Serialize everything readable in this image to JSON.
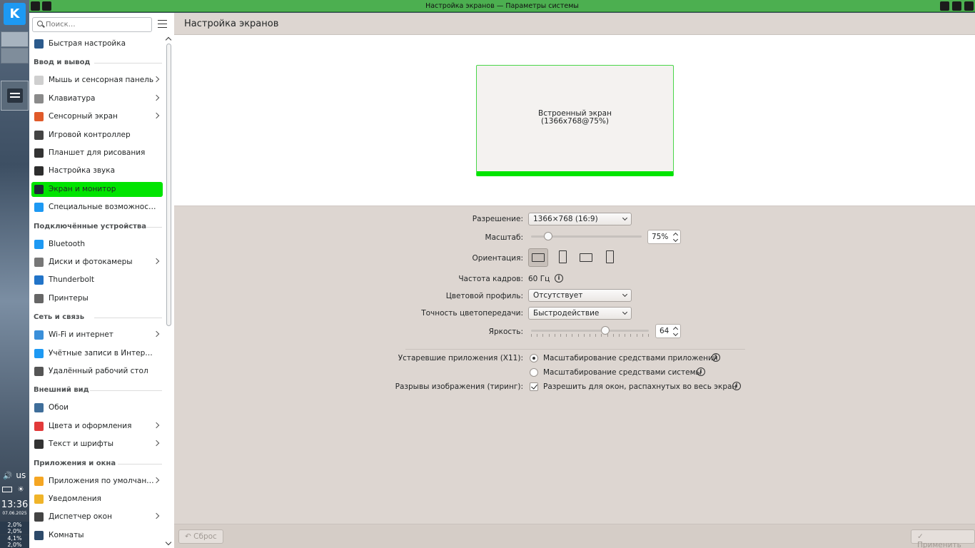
{
  "window": {
    "title": "Настройка экранов — Параметры системы"
  },
  "panel": {
    "keyboard_layout": "us",
    "clock": "13:36",
    "date": "07.06.2025",
    "cpu_row1": "2,0% 2,0%",
    "cpu_row2": "4,1% 2,0%"
  },
  "sidebar": {
    "search_placeholder": "Поиск…",
    "items": [
      {
        "label": "Быстрая настройка",
        "color": "#2b5a8c"
      },
      {
        "section": "Ввод и вывод"
      },
      {
        "label": "Мышь и сенсорная панель",
        "color": "#cfcfcf"
      },
      {
        "label": "Клавиатура",
        "color": "#8a8a8a"
      },
      {
        "label": "Сенсорный экран",
        "color": "#e05a2a"
      },
      {
        "label": "Игровой контроллер",
        "color": "#444444"
      },
      {
        "label": "Планшет для рисования",
        "color": "#333333"
      },
      {
        "label": "Настройка звука",
        "color": "#2d2d2d"
      },
      {
        "label": "Экран и монитор",
        "color": "#1f2a36"
      },
      {
        "label": "Специальные возможнос…",
        "color": "#1d99f3"
      },
      {
        "section": "Подключённые устройства"
      },
      {
        "label": "Bluetooth",
        "color": "#1d99f3"
      },
      {
        "label": "Диски и фотокамеры",
        "color": "#777777"
      },
      {
        "label": "Thunderbolt",
        "color": "#2274c8"
      },
      {
        "label": "Принтеры",
        "color": "#666666"
      },
      {
        "section": "Сеть и связь"
      },
      {
        "label": "Wi-Fi и интернет",
        "color": "#3a8fd9"
      },
      {
        "label": "Учётные записи в Интер…",
        "color": "#1d99f3"
      },
      {
        "label": "Удалённый рабочий стол",
        "color": "#555555"
      },
      {
        "section": "Внешний вид"
      },
      {
        "label": "Обои",
        "color": "#3f6e9a"
      },
      {
        "label": "Цвета и оформления",
        "color": "#e23a3a"
      },
      {
        "label": "Текст и шрифты",
        "color": "#333333"
      },
      {
        "section": "Приложения и окна"
      },
      {
        "label": "Приложения по умолчан…",
        "color": "#f5a623"
      },
      {
        "label": "Уведомления",
        "color": "#f0b429"
      },
      {
        "label": "Диспетчер окон",
        "color": "#444444"
      },
      {
        "label": "Комнаты",
        "color": "#2d4a6a"
      }
    ]
  },
  "main": {
    "title": "Настройка экранов",
    "screen_name": "Встроенный экран",
    "screen_mode": "(1366x768@75%)",
    "resolution_label": "Разрешение:",
    "resolution_value": "1366×768 (16:9)",
    "scale_label": "Масштаб:",
    "scale_value": "75%",
    "scale_fraction": 0.125,
    "orientation_label": "Ориентация:",
    "refresh_label": "Частота кадров:",
    "refresh_value": "60 Гц",
    "color_profile_label": "Цветовой профиль:",
    "color_profile_value": "Отсутствует",
    "color_accuracy_label": "Точность цветопередачи:",
    "color_accuracy_value": "Быстродействие",
    "brightness_label": "Яркость:",
    "brightness_value": "64",
    "brightness_fraction": 0.64,
    "legacy_label": "Устаревшие приложения (X11):",
    "legacy_opt1": "Масштабирование средствами приложений",
    "legacy_opt2": "Масштабирование средствами системы",
    "tearing_label": "Разрывы изображения (тиринг):",
    "tearing_opt": "Разрешить для окон, распахнутых во весь экран",
    "info_glyph": "i"
  },
  "footer": {
    "reset": "Сброс",
    "apply": "Применить"
  },
  "colors": {
    "accent": "#00e400",
    "titlebar": "#4caf50"
  }
}
